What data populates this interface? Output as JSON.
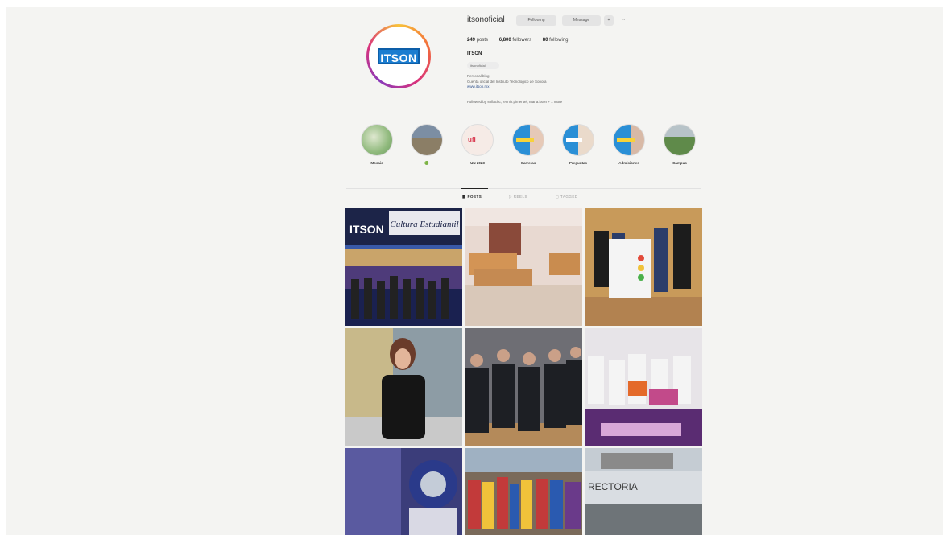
{
  "profile": {
    "username": "itsonoficial",
    "buttons": {
      "following": "Following",
      "message": "Message",
      "add": "+"
    },
    "more_label": "···",
    "stats": {
      "posts": "249",
      "posts_label": "posts",
      "followers": "6,800",
      "followers_label": "followers",
      "following": "80",
      "following_label": "following"
    },
    "full_name": "ITSON",
    "threads": "itsonoficial",
    "bio_line1": "Personal blog",
    "bio_line2": "Cuenta oficial del Instituto Tecnológico de Sonora",
    "bio_link": "www.itson.mx",
    "followed_by": "Followed by sofiachc, jennifr.pimentel, maria.itson + 1 more",
    "avatar_text": "ITSON"
  },
  "highlights": [
    {
      "label": "Mosaic",
      "color": "#a8c98a"
    },
    {
      "label": "🟢",
      "color": "#7a8a9a"
    },
    {
      "label": "UN 2023",
      "color": "#f4e7e2"
    },
    {
      "label": "Carreras",
      "color": "#2a8fd6"
    },
    {
      "label": "Preguntas",
      "color": "#2a8fd6"
    },
    {
      "label": "Admisiones",
      "color": "#2a8fd6"
    },
    {
      "label": "Campus",
      "color": "#6a8a5a"
    }
  ],
  "tabs": {
    "posts": "POSTS",
    "reels": "REELS",
    "tagged": "TAGGED"
  },
  "posts": [
    {
      "caption": "ITSON",
      "banner": "Cultura Estudiantil"
    },
    {
      "caption": ""
    },
    {
      "caption": ""
    },
    {
      "caption": ""
    },
    {
      "caption": ""
    },
    {
      "caption": ""
    },
    {
      "caption": ""
    },
    {
      "caption": ""
    },
    {
      "caption": "RECTORIA"
    }
  ]
}
